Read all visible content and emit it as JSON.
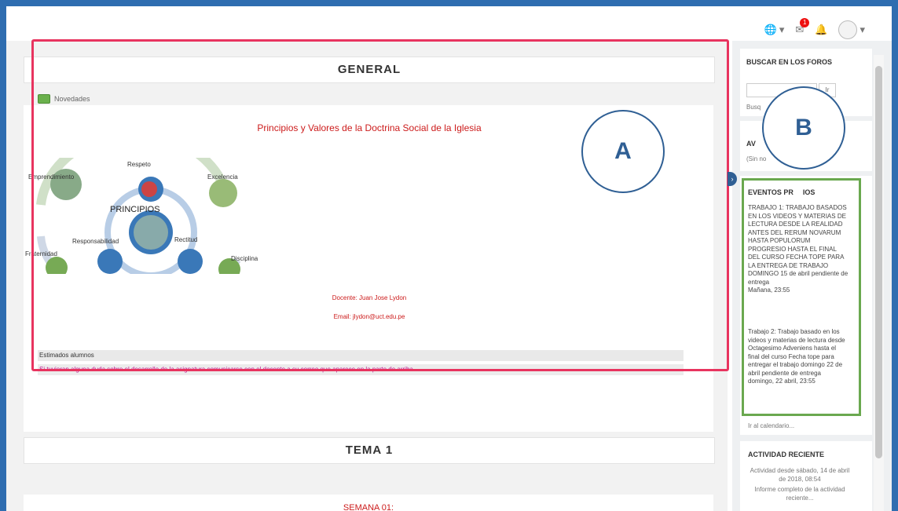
{
  "topbar": {
    "language_icon": "globe-icon",
    "messages_badge": "1",
    "notifications_icon": "bell-icon"
  },
  "main": {
    "general_title": "GENERAL",
    "news_label": "Novedades",
    "course_title": "Principios y Valores de la Doctrina Social de la Iglesia",
    "diagram": {
      "center": "PRINCIPIOS",
      "labels": [
        "Respeto",
        "Emprendimiento",
        "Excelencia",
        "Responsabilidad",
        "Rectitud",
        "Fraternidad",
        "Disciplina"
      ]
    },
    "teacher": "Docente: Juan Jose Lydon",
    "email": "Email: jlydon@uct.edu.pe",
    "students_heading": "Estimados alumnos",
    "students_message": "Si tuvieran alguna duda sobre el desarrollo de la asignatura comunicarse con el docente a su correo que aparece en la parte de arriba.",
    "tema_title": "TEMA 1",
    "semana_label": "SEMANA 01:"
  },
  "annotations": {
    "a": "A",
    "b": "B"
  },
  "colors": {
    "highlight_a": "#e8345f",
    "highlight_b": "#6aa84f",
    "frame": "#2f6db0"
  },
  "sidebar": {
    "search_title": "BUSCAR EN LOS FOROS",
    "search_button": "Ir",
    "search_advanced": "Busq",
    "avisos_title": "AV",
    "avisos_text": "(Sin no",
    "events_title": "EVENTOS PR",
    "events_title_tail": "IOS",
    "events": [
      {
        "text": "TRABAJO 1: TRABAJO BASADOS EN LOS VIDEOS Y MATERIAS DE LECTURA DESDE LA REALIDAD ANTES DEL RERUM NOVARUM HASTA POPULORUM PROGRESIO HASTA EL FINAL DEL CURSO FECHA TOPE PARA LA ENTREGA DE TRABAJO DOMINGO 15 de abril pendiente de entrega",
        "date": "Mañana, 23:55"
      },
      {
        "text": "Trabajo 2: Trabajo basado en los videos y materias de lectura desde Octagesimo Adveniens hasta el final del curso Fecha tope para entregar el trabajo domingo 22 de abril pendiente de entrega",
        "date": "domingo, 22 abril, 23:55"
      }
    ],
    "calendar_link": "Ir al calendario...",
    "recent_title": "ACTIVIDAD RECIENTE",
    "recent_text": "Actividad desde sábado, 14 de abril de 2018, 08:54",
    "recent_link": "Informe completo de la actividad reciente..."
  }
}
